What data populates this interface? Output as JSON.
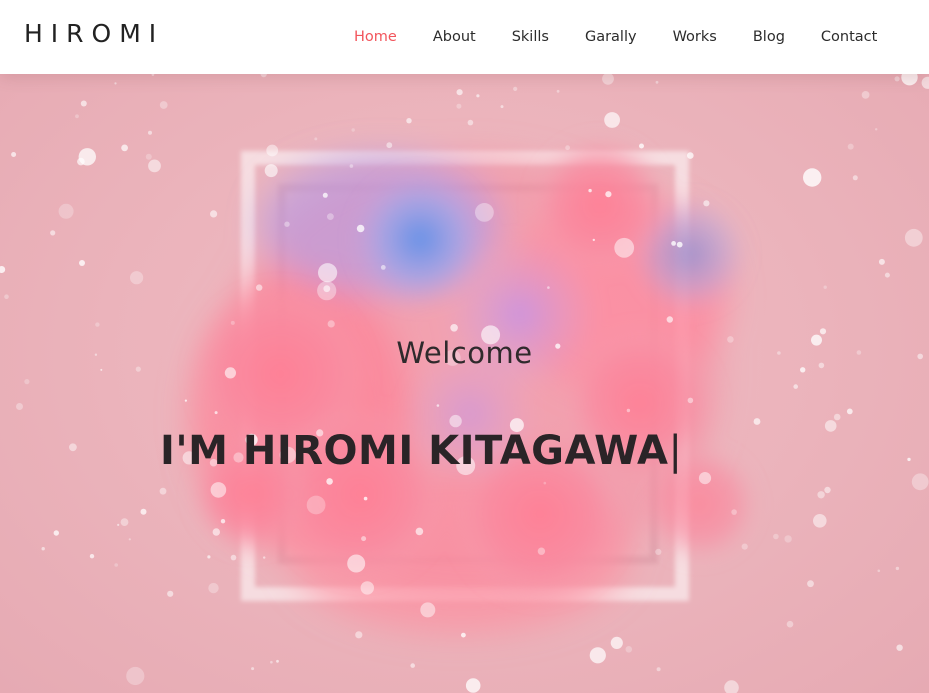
{
  "brand": {
    "logo_text": "HIROMI"
  },
  "nav": {
    "items": [
      {
        "label": "Home",
        "active": true
      },
      {
        "label": "About",
        "active": false
      },
      {
        "label": "Skills",
        "active": false
      },
      {
        "label": "Garally",
        "active": false
      },
      {
        "label": "Works",
        "active": false
      },
      {
        "label": "Blog",
        "active": false
      },
      {
        "label": "Contact",
        "active": false
      }
    ]
  },
  "hero": {
    "welcome": "Welcome",
    "headline": "I'M HIROMI KITAGAWA",
    "cursor": "|"
  },
  "colors": {
    "accent": "#f2555c",
    "hero_background": "#eab2ba",
    "text_dark": "#2a2427"
  }
}
